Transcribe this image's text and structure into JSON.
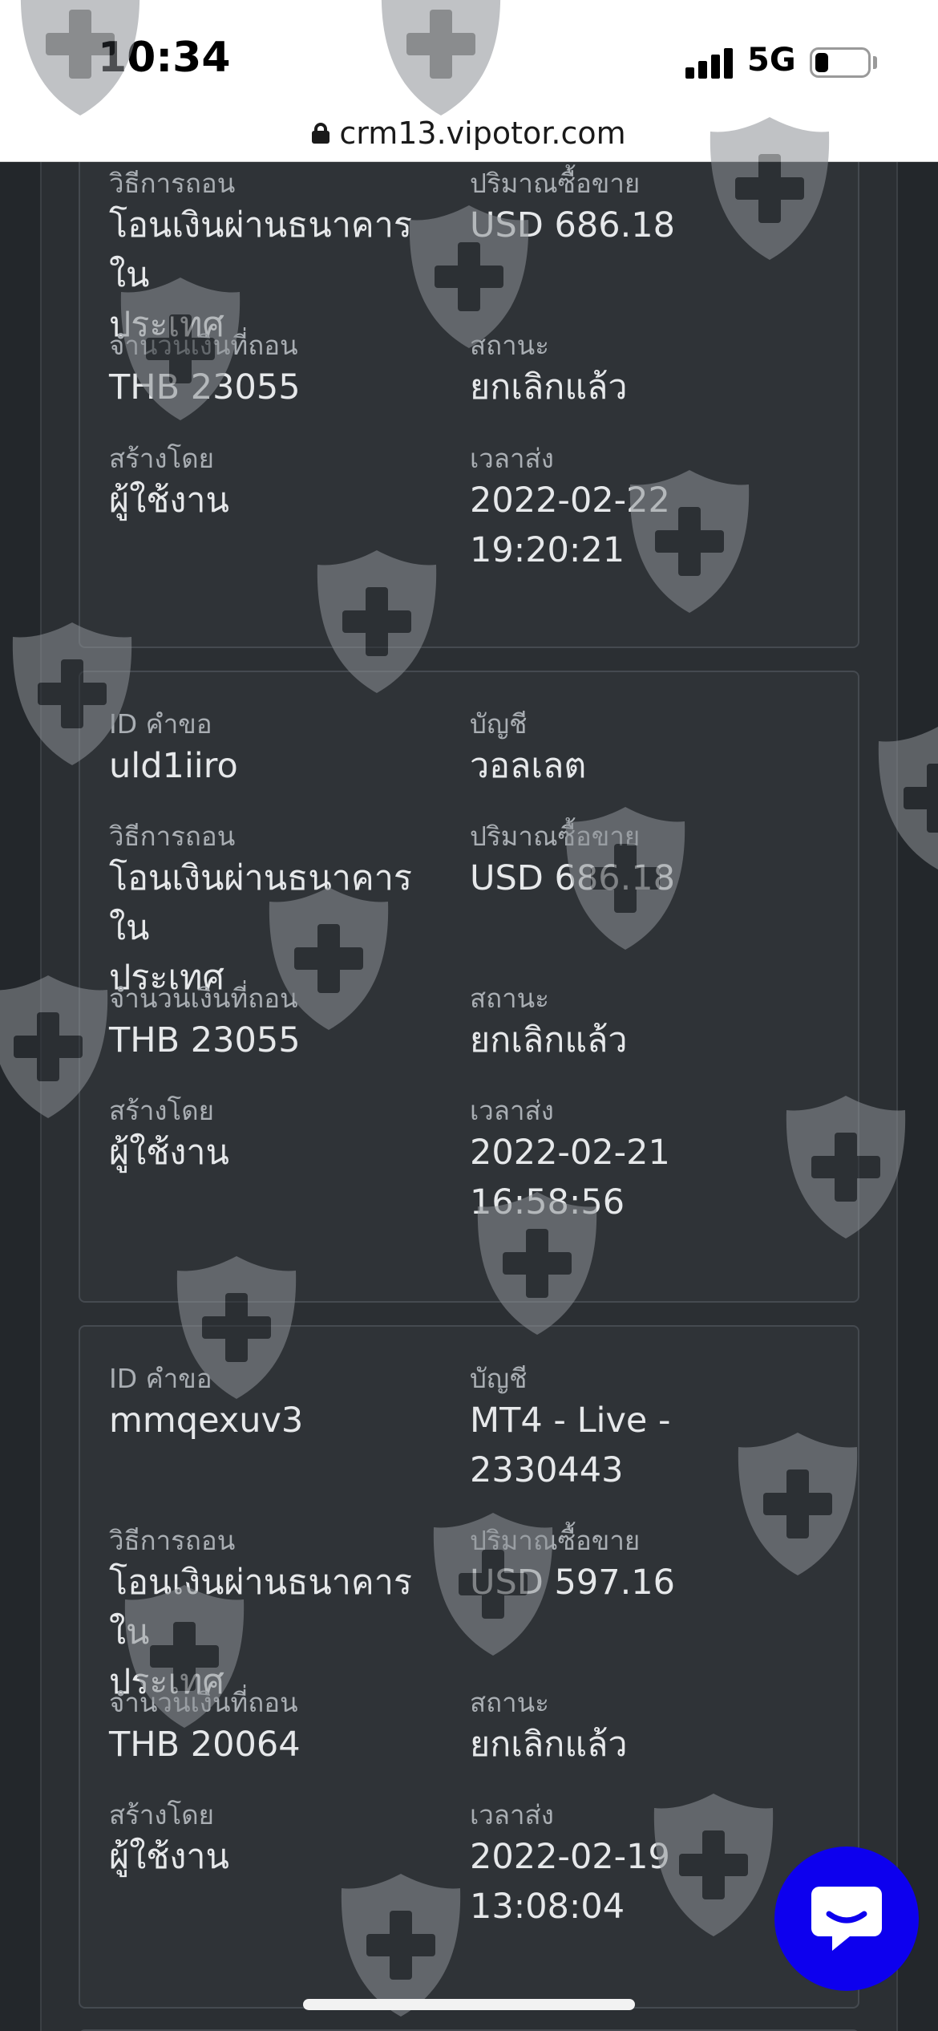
{
  "status_bar": {
    "time": "10:34",
    "network": "5G",
    "battery_level": 0.25
  },
  "browser": {
    "url": "crm13.vipotor.com"
  },
  "labels": {
    "request_id": "ID คำขอ",
    "account": "บัญชี",
    "method": "วิธีการถอน",
    "trade_amount": "ปริมาณซื้อขาย",
    "withdraw_amount": "จำนวนเงินที่ถอน",
    "status": "สถานะ",
    "created_by": "สร้างโดย",
    "submitted_time": "เวลาส่ง"
  },
  "cards": [
    {
      "method": [
        "โอนเงินผ่านธนาคารใน",
        "ประเทศ"
      ],
      "trade_amount": "USD 686.18",
      "withdraw_amount": "THB 23055",
      "status": "ยกเลิกแล้ว",
      "created_by": "ผู้ใช้งาน",
      "time": [
        "2022-02-22",
        "19:20:21"
      ]
    },
    {
      "request_id": "uld1iiro",
      "account": [
        "วอลเลต"
      ],
      "method": [
        "โอนเงินผ่านธนาคารใน",
        "ประเทศ"
      ],
      "trade_amount": "USD 686.18",
      "withdraw_amount": "THB 23055",
      "status": "ยกเลิกแล้ว",
      "created_by": "ผู้ใช้งาน",
      "time": [
        "2022-02-21",
        "16:58:56"
      ]
    },
    {
      "request_id": "mmqexuv3",
      "account": [
        "MT4 - Live -",
        "2330443"
      ],
      "method": [
        "โอนเงินผ่านธนาคารใน",
        "ประเทศ"
      ],
      "trade_amount": "USD 597.16",
      "withdraw_amount": "THB 20064",
      "status": "ยกเลิกแล้ว",
      "created_by": "ผู้ใช้งาน",
      "time": [
        "2022-02-19",
        "13:08:04"
      ]
    }
  ],
  "colors": {
    "background": "#23272b",
    "card": "#2f3337",
    "chat_button": "#0d00ee"
  },
  "icons": [
    "lock-icon",
    "shield-watermark-icon",
    "chat-icon",
    "signal-icon",
    "battery-icon"
  ]
}
